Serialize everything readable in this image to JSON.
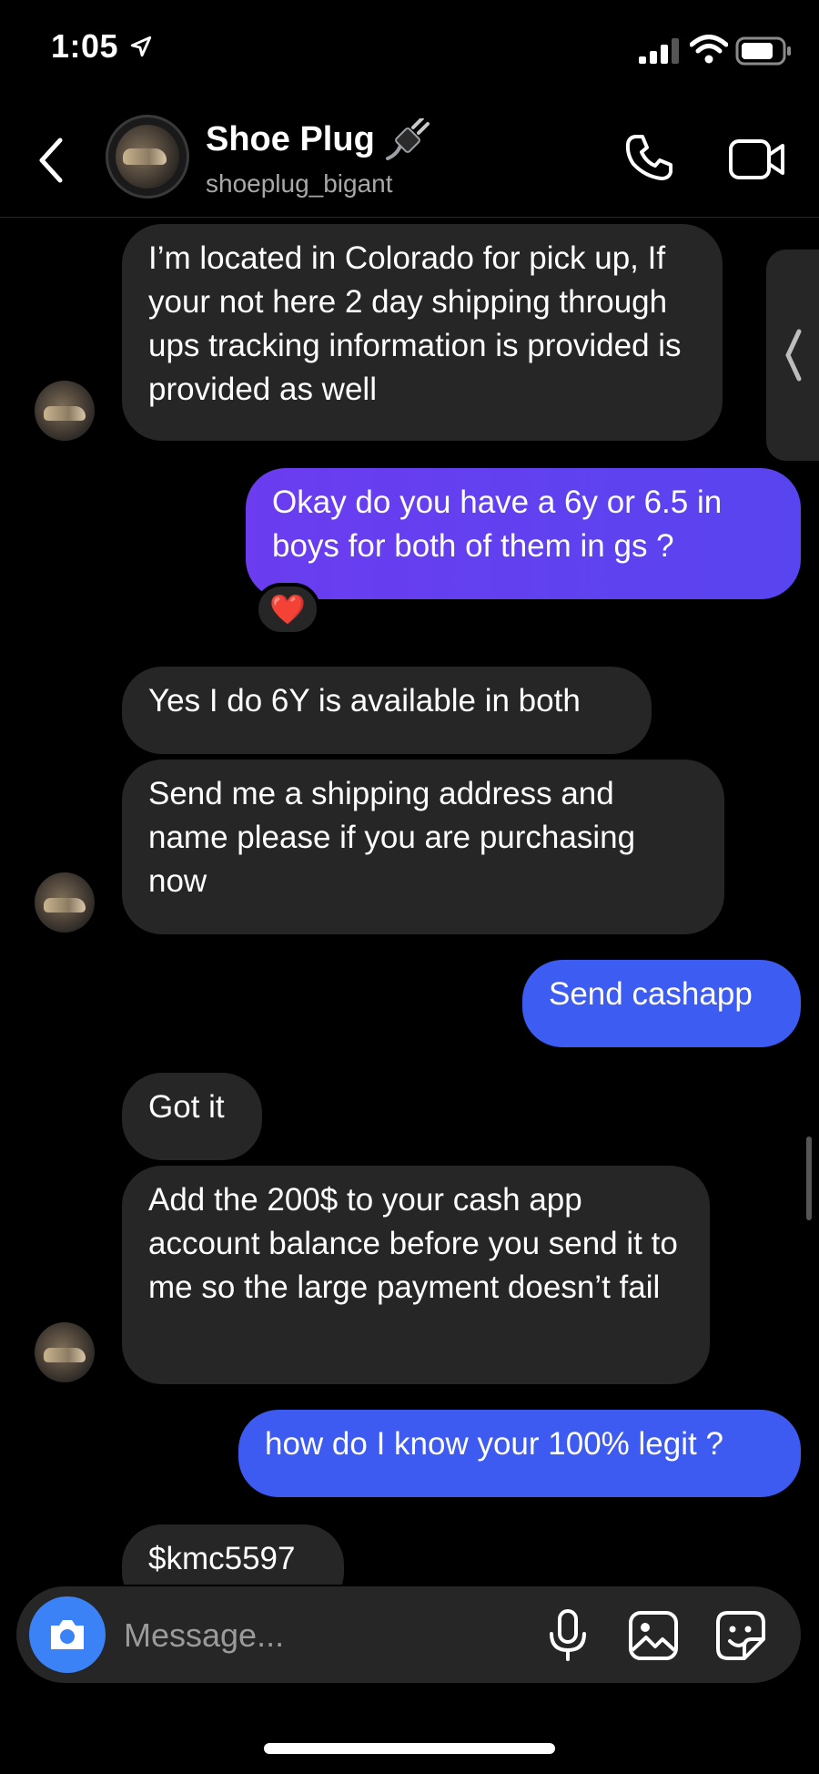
{
  "status_bar": {
    "time": "1:05",
    "icons": [
      "location-arrow-icon",
      "cellular-signal-icon",
      "wifi-icon",
      "battery-icon"
    ]
  },
  "header": {
    "contact_name": "Shoe Plug",
    "handle": "shoeplug_bigant",
    "icons": [
      "back-chevron-icon",
      "plug-emoji-icon",
      "phone-icon",
      "video-camera-icon"
    ]
  },
  "messages": [
    {
      "from": "them",
      "text": "I’m located in Colorado for pick up, If your not here 2 day shipping through ups tracking information is provided is provided as well"
    },
    {
      "from": "me",
      "text": "Okay do you have a 6y or 6.5 in boys for both of them in gs ?",
      "reaction": "❤️"
    },
    {
      "from": "them",
      "text": "Yes I do 6Y is available in both"
    },
    {
      "from": "them",
      "text": "Send me a shipping address and name please if you are purchasing now"
    },
    {
      "from": "me",
      "text": "Send cashapp"
    },
    {
      "from": "them",
      "text": "Got it"
    },
    {
      "from": "them",
      "text": "Add the 200$ to your cash app account balance before you send it to me so the large payment doesn’t fail"
    },
    {
      "from": "me",
      "text": "how do I know your 100% legit ?"
    },
    {
      "from": "them",
      "text": "$kmc5597"
    }
  ],
  "composer": {
    "placeholder": "Message...",
    "icons": [
      "camera-icon",
      "microphone-icon",
      "gallery-icon",
      "sticker-icon"
    ]
  },
  "colors": {
    "incoming_bubble": "#262626",
    "outgoing_purple": "#5b3cf0",
    "outgoing_blue": "#3d5bf0",
    "camera_button": "#3b82f6",
    "background": "#000000"
  }
}
